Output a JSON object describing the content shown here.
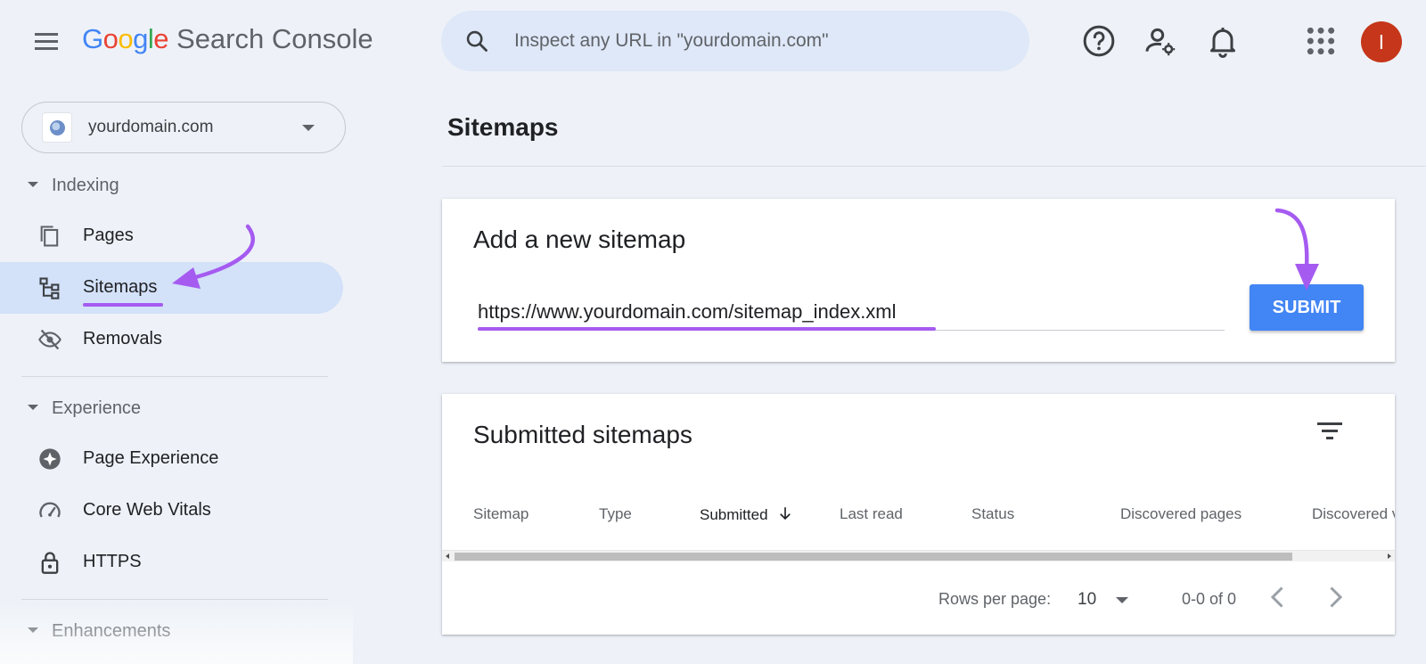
{
  "header": {
    "logo_letters": [
      "G",
      "o",
      "o",
      "g",
      "l",
      "e"
    ],
    "logo_colors": [
      "#4285F4",
      "#EA4335",
      "#FBBC05",
      "#4285F4",
      "#34A853",
      "#EA4335"
    ],
    "product_name": "Search Console",
    "search_placeholder": "Inspect any URL in \"yourdomain.com\"",
    "avatar_initial": "I",
    "icons": [
      "menu-icon",
      "search-icon",
      "help-icon",
      "manage-users-icon",
      "notifications-icon",
      "apps-grid-icon"
    ]
  },
  "property": {
    "domain": "yourdomain.com"
  },
  "sidebar": {
    "sections": [
      {
        "label": "Indexing"
      },
      {
        "label": "Experience"
      },
      {
        "label": "Enhancements"
      }
    ],
    "items": [
      {
        "label": "Pages",
        "icon": "pages-icon"
      },
      {
        "label": "Sitemaps",
        "icon": "sitemap-icon",
        "active": true
      },
      {
        "label": "Removals",
        "icon": "removals-icon"
      },
      {
        "label": "Page Experience",
        "icon": "page-experience-icon"
      },
      {
        "label": "Core Web Vitals",
        "icon": "speedometer-icon"
      },
      {
        "label": "HTTPS",
        "icon": "lock-icon"
      }
    ]
  },
  "main": {
    "page_title": "Sitemaps",
    "add_card": {
      "title": "Add a new sitemap",
      "url_value": "https://www.yourdomain.com/sitemap_index.xml",
      "submit_label": "SUBMIT"
    },
    "submitted_card": {
      "title": "Submitted sitemaps",
      "columns": [
        "Sitemap",
        "Type",
        "Submitted",
        "Last read",
        "Status",
        "Discovered pages",
        "Discovered v"
      ],
      "sorted_column": "Submitted",
      "rows_per_page_label": "Rows per page:",
      "rows_per_page_value": "10",
      "range_text": "0-0 of 0"
    }
  },
  "colors": {
    "accent": "#4285F4",
    "active_nav": "#D3E1F9",
    "annotation": "#A55BF0",
    "avatar": "#C5361A"
  }
}
